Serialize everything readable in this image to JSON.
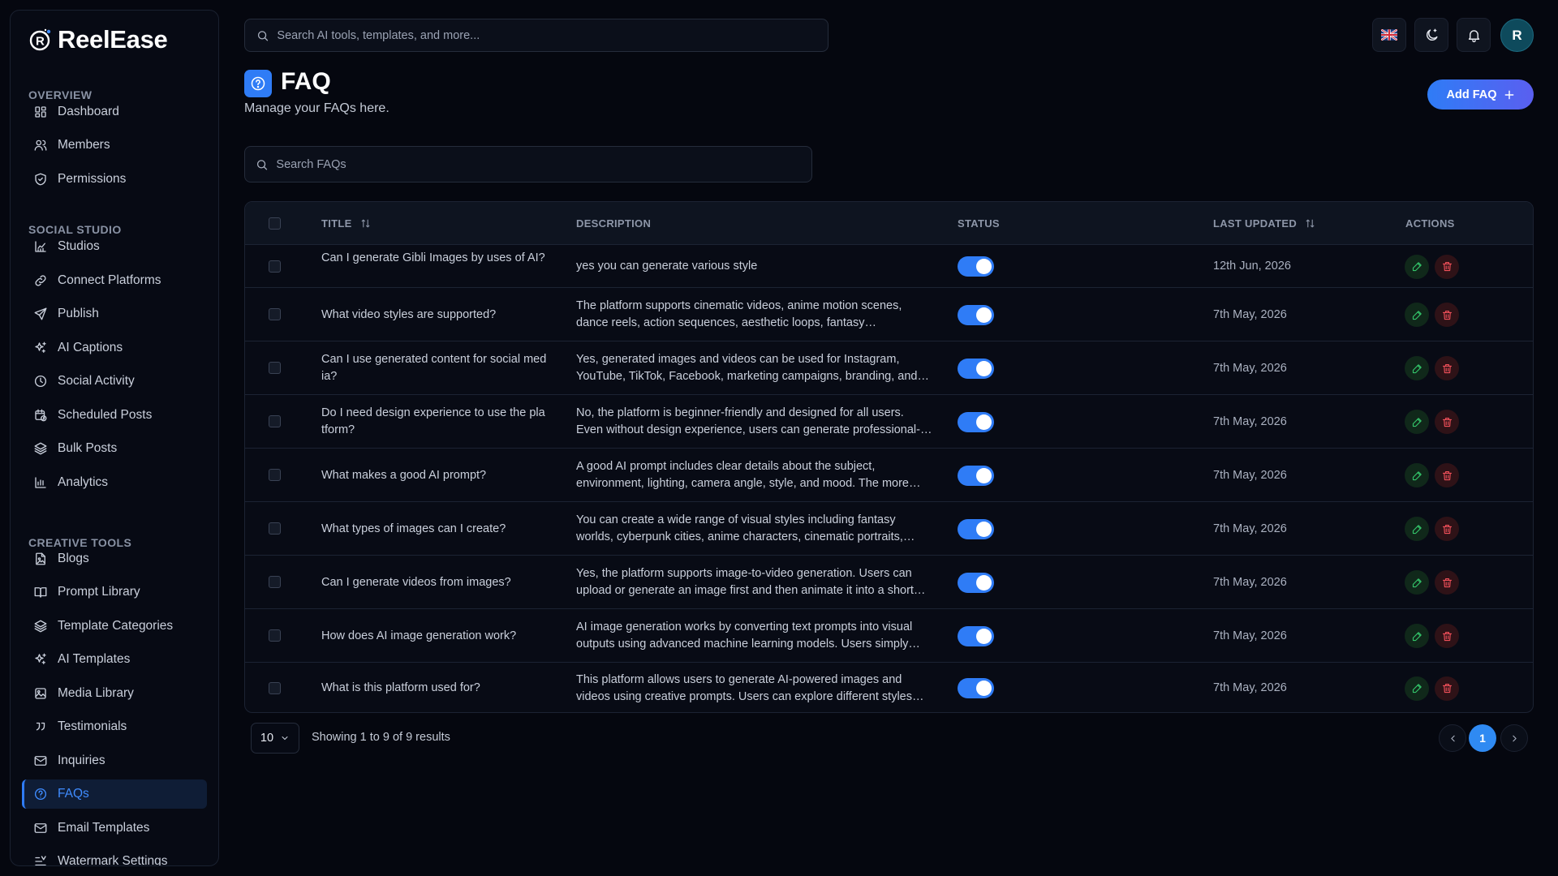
{
  "brand": {
    "name": "ReelEase"
  },
  "sidebar": {
    "sections": [
      {
        "label": "OVERVIEW",
        "items": [
          {
            "label": "Dashboard",
            "icon": "dashboard-icon"
          },
          {
            "label": "Members",
            "icon": "users-icon"
          },
          {
            "label": "Permissions",
            "icon": "shield-icon"
          }
        ]
      },
      {
        "label": "SOCIAL STUDIO",
        "items": [
          {
            "label": "Studios",
            "icon": "chart-icon"
          },
          {
            "label": "Connect Platforms",
            "icon": "link-icon"
          },
          {
            "label": "Publish",
            "icon": "send-icon"
          },
          {
            "label": "AI Captions",
            "icon": "sparkles-icon"
          },
          {
            "label": "Social Activity",
            "icon": "clock-icon"
          },
          {
            "label": "Scheduled Posts",
            "icon": "calendar-clock-icon"
          },
          {
            "label": "Bulk Posts",
            "icon": "layers-icon"
          },
          {
            "label": "Analytics",
            "icon": "bar-chart-icon"
          }
        ]
      },
      {
        "label": "CREATIVE TOOLS",
        "items": [
          {
            "label": "Blogs",
            "icon": "file-image-icon"
          },
          {
            "label": "Prompt Library",
            "icon": "book-icon"
          },
          {
            "label": "Template Categories",
            "icon": "layers-icon"
          },
          {
            "label": "AI Templates",
            "icon": "sparkles-icon"
          },
          {
            "label": "Media Library",
            "icon": "image-icon"
          },
          {
            "label": "Testimonials",
            "icon": "quote-icon"
          },
          {
            "label": "Inquiries",
            "icon": "mail-icon"
          },
          {
            "label": "FAQs",
            "icon": "help-circle-icon",
            "active": true
          },
          {
            "label": "Email Templates",
            "icon": "mail-icon"
          },
          {
            "label": "Watermark Settings",
            "icon": "text-settings-icon"
          }
        ]
      }
    ]
  },
  "topbar": {
    "search_placeholder": "Search AI tools, templates, and more...",
    "avatar_initial": "R"
  },
  "page": {
    "title": "FAQ",
    "subtitle": "Manage your FAQs here.",
    "add_button": "Add FAQ",
    "search_placeholder": "Search FAQs"
  },
  "table": {
    "headers": {
      "title": "TITLE",
      "description": "DESCRIPTION",
      "status": "STATUS",
      "last_updated": "LAST UPDATED",
      "actions": "ACTIONS"
    },
    "rows": [
      {
        "title": "Can I generate Gibli Images by uses of AI?",
        "description": "yes you can generate various style",
        "status": true,
        "updated": "12th Jun, 2026"
      },
      {
        "title": "What video styles are supported?",
        "description": "The platform supports cinematic videos, anime motion scenes, dance reels, action sequences, aesthetic loops, fantasy…",
        "status": true,
        "updated": "7th May, 2026"
      },
      {
        "title": "Can I use generated content for social med ia?",
        "description": "Yes, generated images and videos can be used for Instagram, YouTube, TikTok, Facebook, marketing campaigns, branding, and…",
        "status": true,
        "updated": "7th May, 2026"
      },
      {
        "title": "Do I need design experience to use the pla tform?",
        "description": "No, the platform is beginner-friendly and designed for all users. Even without design experience, users can generate professional-…",
        "status": true,
        "updated": "7th May, 2026"
      },
      {
        "title": "What makes a good AI prompt?",
        "description": "A good AI prompt includes clear details about the subject, environment, lighting, camera angle, style, and mood. The more…",
        "status": true,
        "updated": "7th May, 2026"
      },
      {
        "title": "What types of images can I create?",
        "description": "You can create a wide range of visual styles including fantasy worlds, cyberpunk cities, anime characters, cinematic portraits,…",
        "status": true,
        "updated": "7th May, 2026"
      },
      {
        "title": "Can I generate videos from images?",
        "description": "Yes, the platform supports image-to-video generation. Users can upload or generate an image first and then animate it into a short…",
        "status": true,
        "updated": "7th May, 2026"
      },
      {
        "title": "How does AI image generation work?",
        "description": "AI image generation works by converting text prompts into visual outputs using advanced machine learning models. Users simply…",
        "status": true,
        "updated": "7th May, 2026"
      },
      {
        "title": "What is this platform used for?",
        "description": "This platform allows users to generate AI-powered images and videos using creative prompts. Users can explore different styles…",
        "status": true,
        "updated": "7th May, 2026"
      }
    ]
  },
  "pagination": {
    "page_size": "10",
    "summary": "Showing 1 to 9 of 9 results",
    "current_page": "1"
  },
  "colors": {
    "accent": "#2f7cf6",
    "background": "#05070f",
    "edit": "#34c46a",
    "delete": "#f0505a"
  }
}
